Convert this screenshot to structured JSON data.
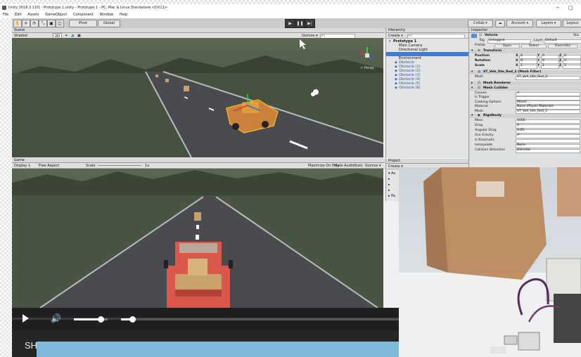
{
  "window": {
    "title": "Unity 2018.3.11f1 - Prototype 1.unity - Prototype 1 - PC, Mac & Linux Standalone <DX11>",
    "controls": [
      "−",
      "□"
    ]
  },
  "menu": [
    "File",
    "Edit",
    "Assets",
    "GameObject",
    "Component",
    "Window",
    "Help"
  ],
  "toolbar": {
    "pivot": "Pivot",
    "global": "Global",
    "collab": "Collab ▾",
    "account": "Account ▾",
    "layers": "Layers ▾",
    "layout": "Layout"
  },
  "scene": {
    "tab": "Scene",
    "shading": "Shaded",
    "mode2d": "2D",
    "gizmos": "Gizmos ▾",
    "search": "All",
    "persp": "< Persp"
  },
  "game": {
    "tab": "Game",
    "display": "Display 1",
    "aspect": "Free Aspect",
    "scale_label": "Scale",
    "scale_value": "1x",
    "options": [
      "Maximize On Play",
      "Mute Audio",
      "Stats",
      "Gizmos ▾"
    ]
  },
  "hierarchy": {
    "tab": "Hierarchy",
    "create": "Create ▾",
    "search": "All",
    "items": [
      {
        "label": "Prototype 1",
        "indent": 0,
        "bold": true
      },
      {
        "label": "Main Camera",
        "indent": 1
      },
      {
        "label": "Directional Light",
        "indent": 1
      },
      {
        "label": "",
        "indent": 1,
        "selected": true
      },
      {
        "label": "Environment",
        "indent": 1
      },
      {
        "label": "Obstacle",
        "indent": 1,
        "blue": true
      },
      {
        "label": "Obstacle (1)",
        "indent": 1,
        "blue": true
      },
      {
        "label": "Obstacle (2)",
        "indent": 1,
        "blue": true
      },
      {
        "label": "Obstacle (3)",
        "indent": 1,
        "blue": true
      },
      {
        "label": "Obstacle (4)",
        "indent": 1,
        "blue": true
      },
      {
        "label": "Obstacle (5)",
        "indent": 1,
        "blue": true
      },
      {
        "label": "Obstacle (6)",
        "indent": 1,
        "blue": true
      }
    ]
  },
  "project": {
    "tab": "Project",
    "create": "Create ▾",
    "rows": [
      "▾ As",
      "▸",
      "▸",
      "▸",
      "▸ Pa"
    ]
  },
  "inspector": {
    "tab": "Inspector",
    "object_name": "Vehicle",
    "static": "Sta",
    "tag_label": "Tag",
    "tag_value": "Untagged",
    "layer_label": "Layer",
    "layer_value": "Default",
    "prefab_label": "Prefab",
    "prefab_buttons": [
      "Open",
      "Select",
      "Overrides"
    ],
    "transform": {
      "header": "Transform",
      "rows": [
        {
          "label": "Position",
          "x": "0",
          "y": "0",
          "z": "0"
        },
        {
          "label": "Rotation",
          "x": "0",
          "y": "0",
          "z": "0"
        },
        {
          "label": "Scale",
          "x": "1",
          "y": "1",
          "z": "1"
        }
      ]
    },
    "mesh_filter": {
      "header": "ST_Veh_Ute_Red_2 (Mesh Filter)",
      "label": "Mesh",
      "value": "ST_Veh_Ute_Red_2"
    },
    "mesh_renderer": {
      "header": "Mesh Renderer"
    },
    "mesh_collider": {
      "header": "Mesh Collider",
      "rows": [
        {
          "label": "Convex",
          "value": "✔"
        },
        {
          "label": "Is Trigger",
          "value": ""
        },
        {
          "label": "Cooking Options",
          "value": "Mixed ..."
        },
        {
          "label": "Material",
          "value": "None (Physic Material)"
        },
        {
          "label": "Mesh",
          "value": "ST_Veh_Ute_Red_2"
        }
      ]
    },
    "rigidbody": {
      "header": "Rigidbody",
      "rows": [
        {
          "label": "Mass",
          "value": "1000"
        },
        {
          "label": "Drag",
          "value": "0"
        },
        {
          "label": "Angular Drag",
          "value": "0.05"
        },
        {
          "label": "Use Gravity",
          "value": "✔"
        },
        {
          "label": "Is Kinematic",
          "value": ""
        },
        {
          "label": "Interpolate",
          "value": "None"
        },
        {
          "label": "Collision Detection",
          "value": "Discrete"
        }
      ]
    }
  },
  "video": {
    "caption": "SH",
    "volume": 0.8,
    "progress": 0.04
  },
  "colors": {
    "sky": "#4d5746",
    "road": "#4a4a4e",
    "truck_red": "#d9574b",
    "box_tan": "#c9a26b",
    "caption_bg": "#262626",
    "blue_bar": "#7fb8d9"
  }
}
